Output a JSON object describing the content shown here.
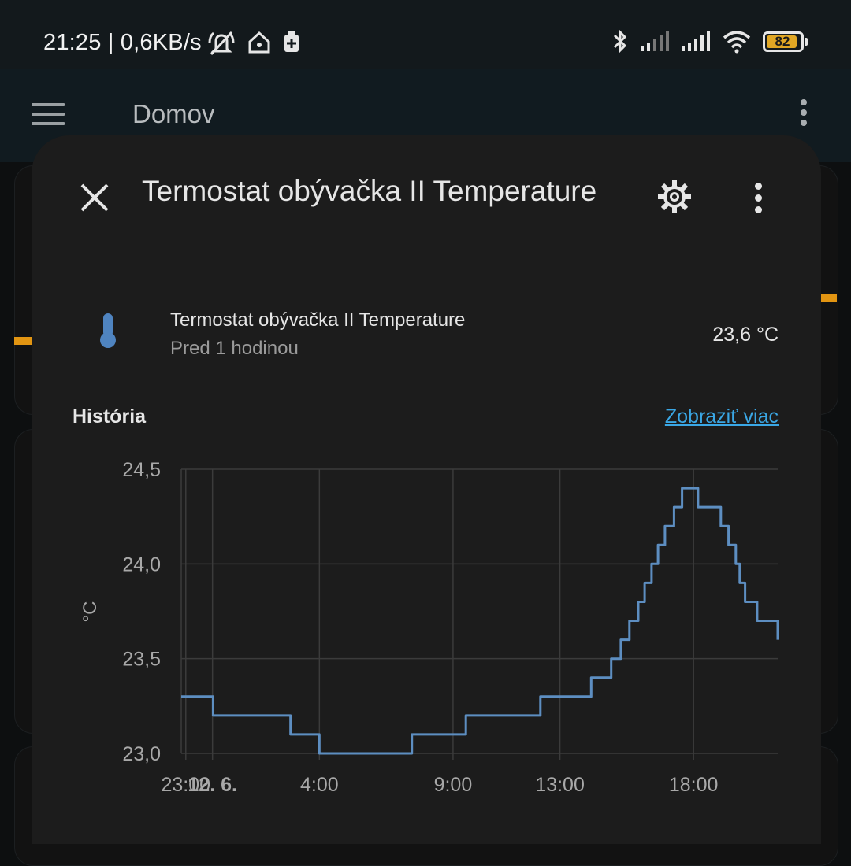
{
  "status_bar": {
    "time_speed": "21:25 | 0,6KB/s",
    "battery": "82",
    "icons_left": [
      "muted-bell-icon",
      "home-icon",
      "sim-toolkit-icon"
    ],
    "icons_right": [
      "bluetooth-icon",
      "signal-icon",
      "signal-icon",
      "wifi-icon",
      "battery-icon"
    ]
  },
  "app_bar": {
    "title": "Domov"
  },
  "dialog": {
    "title": "Termostat obývačka II Temperature",
    "entity": {
      "name": "Termostat obývačka II Temperature",
      "last_changed": "Pred 1 hodinou",
      "value": "23,6 °C",
      "icon": "thermometer-icon"
    },
    "history_label": "História",
    "show_more": "Zobraziť viac"
  },
  "colors": {
    "line": "#5d8ec1",
    "grid": "#3b3b3b",
    "accent": "#e29512",
    "link": "#3aa7e5",
    "thermometer": "#4f84c0"
  },
  "chart_data": {
    "type": "line",
    "step": true,
    "ylabel": "°C",
    "ylim": [
      23.0,
      24.5
    ],
    "yticks": [
      "24,5",
      "24,0",
      "23,5",
      "23,0"
    ],
    "xticks": [
      "23:00",
      "12. 6.",
      "4:00",
      "9:00",
      "13:00",
      "18:00"
    ],
    "x_hours": [
      -1.17,
      -0.71,
      0.02,
      1.07,
      1.63,
      2.92,
      4.0,
      4.02,
      7.46,
      7.97,
      9.48,
      12.0,
      12.27,
      13.3,
      14.17,
      14.53,
      14.92,
      15.28,
      15.6,
      15.93,
      16.17,
      16.43,
      16.67,
      16.93,
      17.27,
      17.57,
      17.68,
      18.17,
      18.8,
      19.02,
      19.31,
      19.58,
      19.73,
      19.93,
      20.38,
      21.15
    ],
    "values": [
      23.3,
      23.3,
      23.2,
      23.2,
      23.2,
      23.1,
      23.0,
      23.0,
      23.1,
      23.1,
      23.2,
      23.2,
      23.3,
      23.3,
      23.4,
      23.4,
      23.5,
      23.6,
      23.7,
      23.8,
      23.9,
      24.0,
      24.1,
      24.2,
      24.3,
      24.4,
      24.4,
      24.3,
      24.3,
      24.2,
      24.1,
      24.0,
      23.9,
      23.8,
      23.7,
      23.6
    ]
  }
}
